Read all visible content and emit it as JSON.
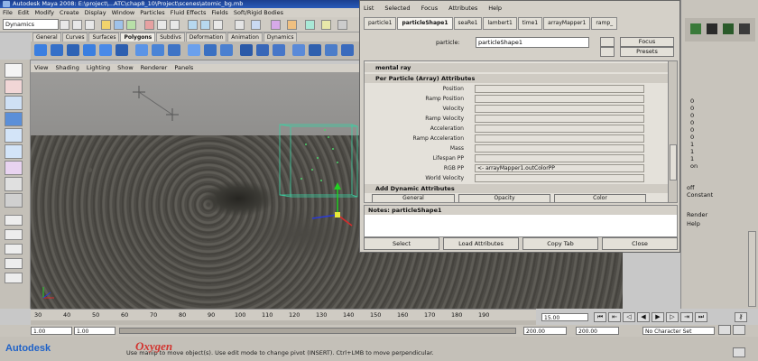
{
  "window": {
    "title": "Autodesk Maya 2008: E:\\project\\...ATC\\chap8_10\\Project\\scenes\\atomic_bg.mb"
  },
  "menubar": [
    "File",
    "Edit",
    "Modify",
    "Create",
    "Display",
    "Window",
    "Particles",
    "Fluid Effects",
    "Fields",
    "Soft/Rigid Bodies"
  ],
  "statusline": {
    "mode_select": "Dynamics"
  },
  "shelf": {
    "tabs": [
      "General",
      "Curves",
      "Surfaces",
      "Polygons",
      "Subdivs",
      "Deformation",
      "Animation",
      "Dynamics"
    ],
    "active_tab": "Polygons"
  },
  "viewport_menu": [
    "View",
    "Shading",
    "Lighting",
    "Show",
    "Renderer",
    "Panels"
  ],
  "attribute_editor": {
    "menu": [
      "List",
      "Selected",
      "Focus",
      "Attributes",
      "Help"
    ],
    "tabs": [
      "particle1",
      "particleShape1",
      "seaRe1",
      "lambert1",
      "time1",
      "arrayMapper1",
      "ramp_"
    ],
    "active_tab": "particleShape1",
    "name_label": "particle:",
    "name_value": "particleShape1",
    "focus_label": "Focus",
    "presets_label": "Presets",
    "section_mental_ray": "mental ray",
    "section_per_particle": "Per Particle (Array) Attributes",
    "attributes": [
      {
        "label": "Position",
        "value": ""
      },
      {
        "label": "Ramp Position",
        "value": ""
      },
      {
        "label": "Velocity",
        "value": ""
      },
      {
        "label": "Ramp Velocity",
        "value": ""
      },
      {
        "label": "Acceleration",
        "value": ""
      },
      {
        "label": "Ramp Acceleration",
        "value": ""
      },
      {
        "label": "Mass",
        "value": ""
      },
      {
        "label": "Lifespan PP",
        "value": ""
      },
      {
        "label": "RGB PP",
        "value": "<- arrayMapper1.outColorPP"
      },
      {
        "label": "World Velocity",
        "value": ""
      }
    ],
    "section_add_dynamic": "Add Dynamic Attributes",
    "dynamic_buttons": [
      "General",
      "Opacity",
      "Color"
    ],
    "notes_label": "Notes: particleShape1",
    "buttons": [
      "Select",
      "Load Attributes",
      "Copy Tab",
      "Close"
    ]
  },
  "channel_box": {
    "values": [
      "0",
      "0",
      "0",
      "0",
      "0",
      "0",
      "1",
      "1",
      "1",
      "on"
    ],
    "labels": [
      "off",
      "Constant"
    ],
    "checks": [
      "Render",
      "Help"
    ]
  },
  "timeline": {
    "ticks": [
      "30",
      "40",
      "50",
      "60",
      "70",
      "80",
      "90",
      "100",
      "110",
      "120",
      "130",
      "140",
      "150",
      "160",
      "170",
      "180",
      "190"
    ],
    "current_frame": "15.00"
  },
  "range": {
    "start": "1.00",
    "inner_start": "1.00",
    "inner_end": "200.00",
    "end": "200.00",
    "character_set": "No Character Set"
  },
  "help_line": "Use manip to move object(s). Use edit mode to change pivot (INSERT). Ctrl+LMB to move perpendicular.",
  "branding": {
    "autodesk": "Autodesk",
    "publisher": "Oxygen"
  }
}
